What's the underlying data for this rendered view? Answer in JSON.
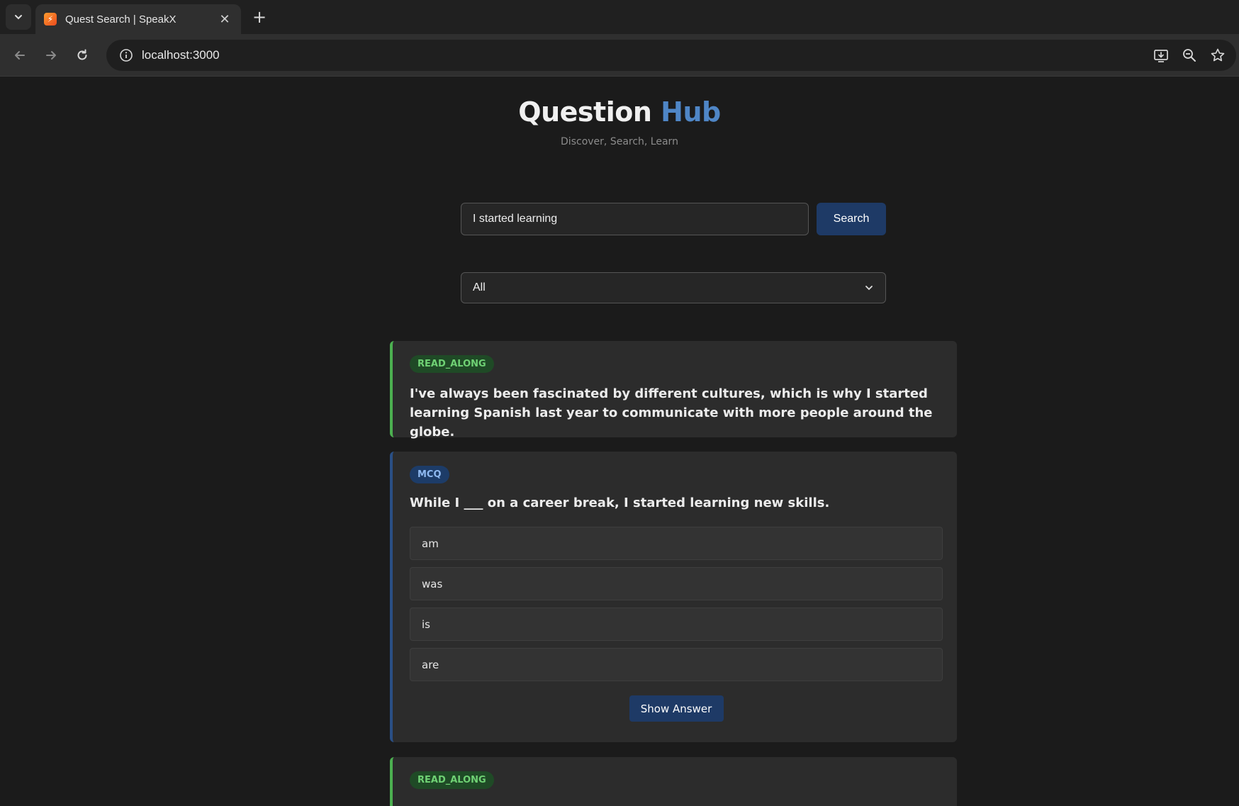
{
  "browser": {
    "tab_title": "Quest Search | SpeakX",
    "tab_close": "✕",
    "new_tab": "+",
    "url": "localhost:3000"
  },
  "header": {
    "title_main": "Question",
    "title_accent": "Hub",
    "subtitle": "Discover, Search, Learn"
  },
  "search": {
    "value": "I started learning",
    "button_label": "Search"
  },
  "filter": {
    "selected": "All"
  },
  "questions": [
    {
      "type": "READ_ALONG",
      "text": "I've always been fascinated by different cultures, which is why I started learning Spanish last year to communicate with more people around the globe."
    },
    {
      "type": "MCQ",
      "text": "While I ___ on a career break, I started learning new skills.",
      "options": [
        "am",
        "was",
        "is",
        "are"
      ],
      "button_label": "Show Answer"
    },
    {
      "type": "READ_ALONG",
      "text": ""
    }
  ],
  "colors": {
    "accent": "#4f86c6",
    "button": "#1e3a66",
    "read_along_border": "#4caf50",
    "mcq_border": "#2a4f85"
  }
}
